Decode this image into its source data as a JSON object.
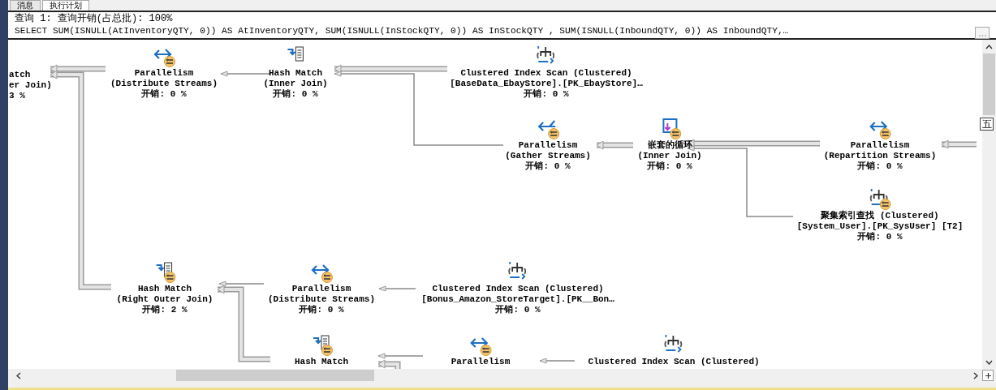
{
  "tabs": [
    {
      "label": "消息",
      "selected": false
    },
    {
      "label": "执行计划",
      "selected": true
    }
  ],
  "query_label": "查询 1: 查询开销(占总批): 100%",
  "sql": "SELECT SUM(ISNULL(AtInventoryQTY, 0)) AS AtInventoryQTY, SUM(ISNULL(InStockQTY, 0)) AS InStockQTY , SUM(ISNULL(InboundQTY, 0)) AS InboundQTY,…",
  "ime_indicator": "五",
  "nodes": [
    {
      "kind": "partial",
      "title": "atch",
      "details": [
        "er Join)"
      ],
      "cost": "3 %"
    },
    {
      "kind": "parallelism",
      "parallel": true,
      "title": "Parallelism",
      "details": [
        "(Distribute Streams)"
      ],
      "cost": "开销: 0 %"
    },
    {
      "kind": "hash",
      "parallel": false,
      "title": "Hash Match",
      "details": [
        "(Inner Join)"
      ],
      "cost": "开销: 0 %"
    },
    {
      "kind": "scan",
      "parallel": false,
      "title": "Clustered Index Scan (Clustered)",
      "details": [
        "[BaseData_EbayStore].[PK_EbayStore]…"
      ],
      "cost": "开销: 0 %"
    },
    {
      "kind": "gather",
      "parallel": true,
      "title": "Parallelism",
      "details": [
        "(Gather Streams)"
      ],
      "cost": "开销: 0 %"
    },
    {
      "kind": "loop",
      "parallel": true,
      "title": "嵌套的循环",
      "details": [
        "(Inner Join)"
      ],
      "cost": "开销: 0 %"
    },
    {
      "kind": "parallelism",
      "parallel": true,
      "title": "Parallelism",
      "details": [
        "(Repartition Streams)"
      ],
      "cost": "开销: 0 %"
    },
    {
      "kind": "scan",
      "parallel": true,
      "title": "聚集索引查找 (Clustered)",
      "details": [
        "[System_User].[PK_SysUser] [T2]"
      ],
      "cost": "开销: 0 %"
    },
    {
      "kind": "hash",
      "parallel": true,
      "title": "Hash Match",
      "details": [
        "(Right Outer Join)"
      ],
      "cost": "开销: 2 %"
    },
    {
      "kind": "parallelism",
      "parallel": true,
      "title": "Parallelism",
      "details": [
        "(Distribute Streams)"
      ],
      "cost": "开销: 0 %"
    },
    {
      "kind": "scan",
      "parallel": false,
      "title": "Clustered Index Scan (Clustered)",
      "details": [
        "[Bonus_Amazon_StoreTarget].[PK__Bon…"
      ],
      "cost": "开销: 0 %"
    },
    {
      "kind": "hash",
      "parallel": true,
      "title": "Hash Match"
    },
    {
      "kind": "parallelism",
      "parallel": true,
      "title": "Parallelism"
    },
    {
      "kind": "scan",
      "parallel": false,
      "title": "Clustered Index Scan (Clustered)"
    }
  ]
}
